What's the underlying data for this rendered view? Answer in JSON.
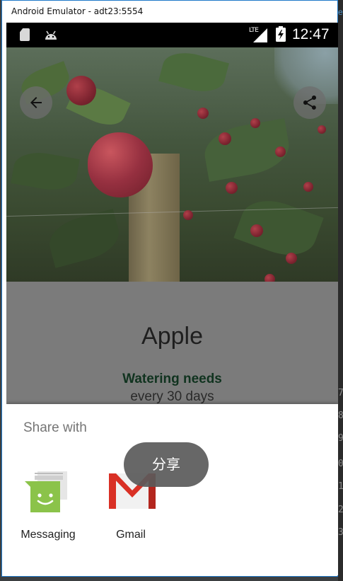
{
  "window": {
    "title": "Android Emulator - adt23:5554"
  },
  "status_bar": {
    "network": "LTE",
    "time": "12:47",
    "icons": [
      "sd-card-icon",
      "android-debug-icon",
      "signal-icon",
      "battery-charging-icon"
    ]
  },
  "hero": {
    "back_icon": "arrow-back-icon",
    "share_icon": "share-icon"
  },
  "detail": {
    "title": "Apple",
    "watering_heading": "Watering needs",
    "watering_value": "every 30 days"
  },
  "share_sheet": {
    "title": "Share with",
    "targets": [
      {
        "label": "Messaging",
        "icon": "messaging-app-icon"
      },
      {
        "label": "Gmail",
        "icon": "gmail-app-icon"
      }
    ]
  },
  "toast": {
    "text": "分享"
  },
  "colors": {
    "window_border": "#1f79c9",
    "heading_green": "#10331f",
    "messaging_green": "#8bc34a",
    "gmail_red": "#d93025"
  }
}
